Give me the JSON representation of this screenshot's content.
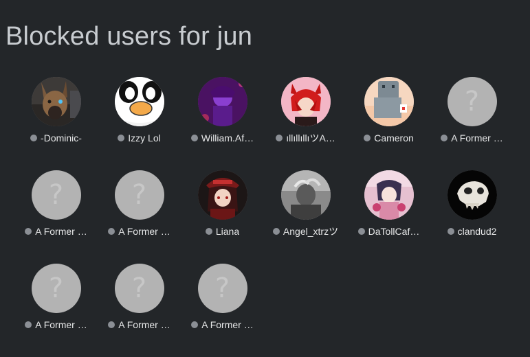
{
  "page": {
    "title": "Blocked users for jun"
  },
  "colors": {
    "background": "#232629",
    "status_offline": "#8b8f95",
    "placeholder_avatar": "#b3b3b3"
  },
  "users": [
    {
      "name": "-Dominic-",
      "avatar": "dog-photo-avatar",
      "status": "offline"
    },
    {
      "name": "Izzy Lol",
      "avatar": "cartoon-goose-avatar",
      "status": "offline"
    },
    {
      "name": "William.Af…",
      "avatar": "purple-anime-avatar",
      "status": "offline"
    },
    {
      "name": "ıllıllıllıツA…",
      "avatar": "red-anime-avatar",
      "status": "offline"
    },
    {
      "name": "Cameron",
      "avatar": "gray-figure-avatar",
      "status": "offline"
    },
    {
      "name": "A Former …",
      "avatar": "placeholder-question",
      "status": "offline"
    },
    {
      "name": "A Former …",
      "avatar": "placeholder-question",
      "status": "offline"
    },
    {
      "name": "A Former …",
      "avatar": "placeholder-question",
      "status": "offline"
    },
    {
      "name": "Liana",
      "avatar": "anime-hat-avatar",
      "status": "offline"
    },
    {
      "name": "Angel_xtrzツ",
      "avatar": "monochrome-photo-avatar",
      "status": "offline"
    },
    {
      "name": "DaTollCaf…",
      "avatar": "pink-anime-avatar",
      "status": "offline"
    },
    {
      "name": "clandud2",
      "avatar": "skull-avatar",
      "status": "offline"
    },
    {
      "name": "A Former …",
      "avatar": "placeholder-question",
      "status": "offline"
    },
    {
      "name": "A Former …",
      "avatar": "placeholder-question",
      "status": "offline"
    },
    {
      "name": "A Former …",
      "avatar": "placeholder-question",
      "status": "offline"
    }
  ],
  "placeholder_glyph": "?"
}
